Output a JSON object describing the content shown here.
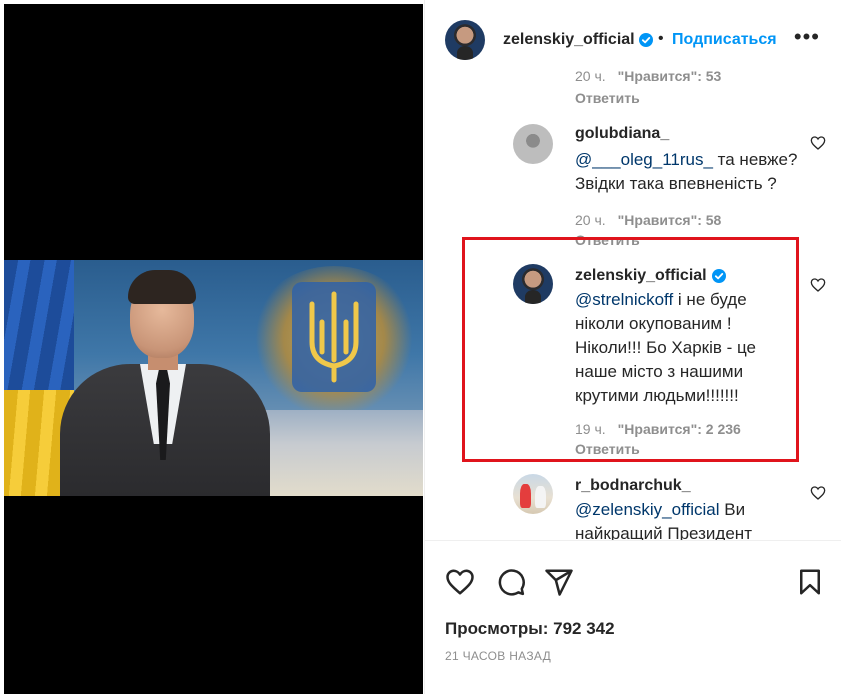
{
  "header": {
    "username": "zelenskiy_official",
    "separator": "•",
    "follow_label": "Подписаться",
    "more_label": "•••"
  },
  "comments": [
    {
      "partial": true,
      "time": "20 ч.",
      "likes": "\"Нравится\": 53",
      "reply": "Ответить"
    },
    {
      "username": "golubdiana_",
      "mention": "@___oleg_11rus_",
      "text": " та невже? Звідки така впевненість ?",
      "time": "20 ч.",
      "likes": "\"Нравится\": 58",
      "reply": "Ответить"
    },
    {
      "username": "zelenskiy_official",
      "verified": true,
      "mention": "@strelnickoff",
      "text": " і не буде ніколи окупованим ! Ніколи!!! Бо Харків - це наше місто з нашими крутими людьми!!!!!!!",
      "time": "19 ч.",
      "likes": "\"Нравится\": 2 236",
      "reply": "Ответить"
    },
    {
      "username": "r_bodnarchuk_",
      "mention": "@zelenskiy_official",
      "text": " Ви найкращий Президент",
      "partial": true
    }
  ],
  "footer": {
    "views": "Просмотры: 792 342",
    "posted": "21 ЧАСОВ НАЗАД"
  },
  "colors": {
    "accent": "#0095f6",
    "highlight": "#e0141c",
    "mention": "#00376b",
    "muted": "#8e8e8e"
  },
  "icons": [
    "verified-badge-icon",
    "heart-icon",
    "comment-icon",
    "share-icon",
    "bookmark-icon"
  ]
}
